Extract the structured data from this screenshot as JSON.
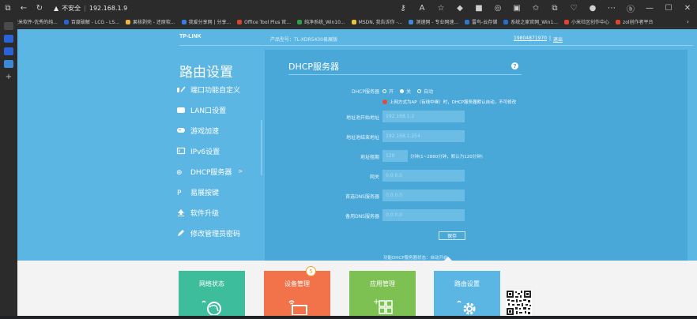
{
  "browser": {
    "security_label": "不安全",
    "url": "192.168.1.9"
  },
  "bookmarks": [
    {
      "label": "壹米软件-优秀的纯...",
      "color": "#e8a13a"
    },
    {
      "label": "百度破解 - LCG - LS...",
      "color": "#2a62d8"
    },
    {
      "label": "果核剥壳 - 还原软...",
      "color": "#f3b23c"
    },
    {
      "label": "我爱分享网 | 分享...",
      "color": "#3a7de0"
    },
    {
      "label": "Office Tool Plus 官...",
      "color": "#d8452e"
    },
    {
      "label": "纯净系统_Win10...",
      "color": "#2fa04a"
    },
    {
      "label": "MSDN, 我告诉你 -...",
      "color": "#f1c232"
    },
    {
      "label": "测速网 - 专业网速...",
      "color": "#3c8ad8"
    },
    {
      "label": "雷鸟-云存储",
      "color": "#2d77d0"
    },
    {
      "label": "系统之家官网_Win1...",
      "color": "#2a6cd3"
    },
    {
      "label": "小米社区创作中心",
      "color": "#e3442f"
    },
    {
      "label": "zol创作者平台",
      "color": "#e3442f"
    }
  ],
  "header": {
    "brand": "TP-LINK",
    "model": "产品型号：TL-XDR5430易展版",
    "phone": "19804871970",
    "separator": "|",
    "exit": "退出"
  },
  "sidebar": {
    "title": "路由设置",
    "items": [
      {
        "label": "端口功能自定义",
        "icon": "port-icon"
      },
      {
        "label": "LAN口设置",
        "icon": "lan-icon"
      },
      {
        "label": "游戏加速",
        "icon": "gamepad-icon"
      },
      {
        "label": "IPv6设置",
        "icon": "ipv6-icon"
      },
      {
        "label": "DHCP服务器",
        "icon": "dhcp-icon",
        "active": true,
        "arrow": ">"
      },
      {
        "label": "易展按键",
        "icon": "easymesh-icon"
      },
      {
        "label": "软件升级",
        "icon": "upgrade-icon"
      },
      {
        "label": "修改管理员密码",
        "icon": "pencil-icon"
      }
    ]
  },
  "panel": {
    "title": "DHCP服务器",
    "help": "?",
    "server_label": "DHCP服务器",
    "radio_on": "开",
    "radio_off": "关",
    "radio_auto": "自动",
    "selected": "关",
    "notice": "上网方式为AP（有线中继）时，DHCP服务器默认自动，不可修改",
    "start_label": "地址池开始地址",
    "start_value": "192.168.1.2",
    "end_label": "地址池结束地址",
    "end_value": "192.168.1.254",
    "lease_label": "地址租期",
    "lease_value": "120",
    "lease_hint": "分钟(1~2880分钟，默认为120分钟)",
    "gateway_label": "网关",
    "gateway_value": "0.0.0.0",
    "dns1_label": "首选DNS服务器",
    "dns1_value": "0.0.0.0",
    "dns2_label": "备用DNS服务器",
    "dns2_value": "0.0.0.0",
    "save": "保存",
    "footnote": "功能DHCP服务器状态：自动开启"
  },
  "tiles": [
    {
      "label": "网络状态",
      "color": "#3dbd9b",
      "icon": "globe-icon"
    },
    {
      "label": "设备管理",
      "color": "#f2724a",
      "icon": "monitor-icon"
    },
    {
      "label": "应用管理",
      "color": "#7cc152",
      "icon": "apps-icon"
    },
    {
      "label": "路由设置",
      "color": "#5bb6e3",
      "icon": "gear-icon"
    }
  ],
  "badge": "5"
}
